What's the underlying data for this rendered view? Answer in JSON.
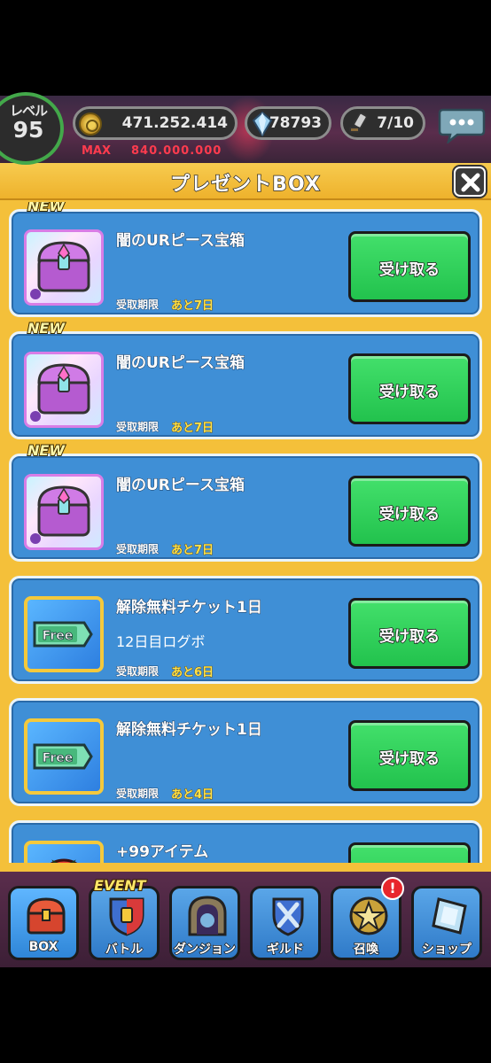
{
  "status": {
    "level_label": "レベル",
    "level_value": "95",
    "coins": "471.252.414",
    "coins_max_label": "MAX",
    "coins_max_value": "840.000.000",
    "gems": "78793",
    "stamina": "7/10",
    "icons": [
      "coin-icon",
      "gem-icon",
      "stamina-sword-icon",
      "chat-bubble-icon"
    ]
  },
  "modal": {
    "title": "プレゼントBOX",
    "close_icon": "close-x-icon",
    "items": [
      {
        "new": "NEW",
        "icon": "treasure-chest-icon",
        "name": "闇のURピース宝箱",
        "note": "",
        "expiry_label": "受取期限",
        "expiry_value": "あと7日",
        "claim_label": "受け取る"
      },
      {
        "new": "NEW",
        "icon": "treasure-chest-icon",
        "name": "闇のURピース宝箱",
        "note": "",
        "expiry_label": "受取期限",
        "expiry_value": "あと7日",
        "claim_label": "受け取る"
      },
      {
        "new": "NEW",
        "icon": "treasure-chest-icon",
        "name": "闇のURピース宝箱",
        "note": "",
        "expiry_label": "受取期限",
        "expiry_value": "あと7日",
        "claim_label": "受け取る"
      },
      {
        "new": "",
        "icon": "free-ticket-icon",
        "icon_text": "Free",
        "name": "解除無料チケット1日",
        "note": "12日目ログボ",
        "expiry_label": "受取期限",
        "expiry_value": "あと6日",
        "claim_label": "受け取る"
      },
      {
        "new": "",
        "icon": "free-ticket-icon",
        "icon_text": "Free",
        "name": "解除無料チケット1日",
        "note": "",
        "expiry_label": "受取期限",
        "expiry_value": "あと4日",
        "claim_label": "受け取る"
      },
      {
        "new": "",
        "icon": "tomato-icon",
        "name": "+99アイテム",
        "note": "",
        "expiry_label": "",
        "expiry_value": "",
        "claim_label": ""
      }
    ]
  },
  "nav": {
    "event_tag": "EVENT",
    "alert": "!",
    "items": [
      {
        "label": "BOX",
        "icon": "box-chest-icon"
      },
      {
        "label": "バトル",
        "icon": "battle-shield-icon"
      },
      {
        "label": "ダンジョン",
        "icon": "dungeon-gate-icon"
      },
      {
        "label": "ギルド",
        "icon": "guild-swords-icon"
      },
      {
        "label": "召喚",
        "icon": "summon-star-icon"
      },
      {
        "label": "ショップ",
        "icon": "shop-crystal-icon"
      }
    ]
  }
}
